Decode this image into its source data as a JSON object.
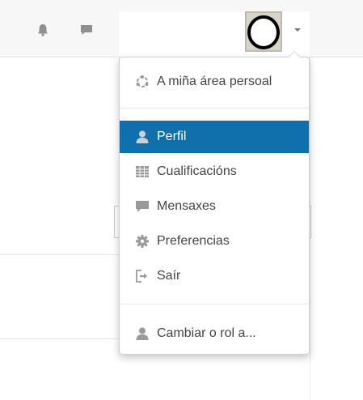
{
  "navbar": {
    "icons": {
      "notifications": "bell-icon",
      "messages": "chat-bubble-icon"
    }
  },
  "user_menu": {
    "items": [
      {
        "label": "A miña área persoal",
        "icon": "dashboard-icon",
        "active": false
      },
      {
        "label": "Perfil",
        "icon": "user-icon",
        "active": true
      },
      {
        "label": "Cualificacións",
        "icon": "grades-table-icon",
        "active": false
      },
      {
        "label": "Mensaxes",
        "icon": "chat-bubble-icon",
        "active": false
      },
      {
        "label": "Preferencias",
        "icon": "gear-icon",
        "active": false
      },
      {
        "label": "Saír",
        "icon": "logout-icon",
        "active": false
      },
      {
        "label": "Cambiar o rol a...",
        "icon": "user-icon",
        "active": false
      }
    ]
  },
  "colors": {
    "active_bg": "#0f71ab",
    "text": "#444444",
    "icon": "#999999"
  }
}
